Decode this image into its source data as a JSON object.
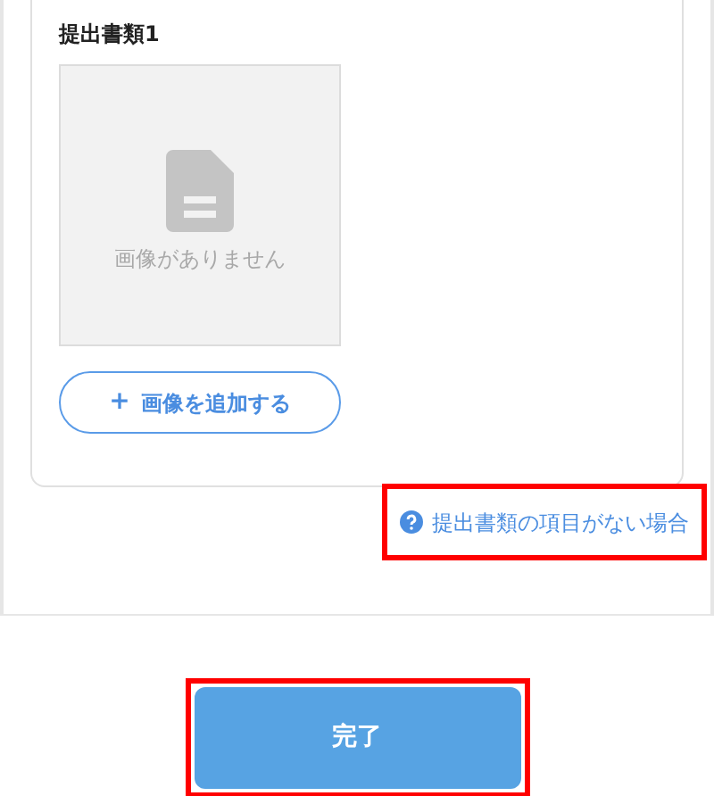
{
  "document_section": {
    "title": "提出書類1",
    "image_placeholder": {
      "text": "画像がありません"
    },
    "add_image_button": {
      "icon": "+",
      "label": "画像を追加する"
    }
  },
  "help_link": {
    "label": "提出書類の項目がない場合",
    "highlighted": true
  },
  "complete_button": {
    "label": "完了",
    "highlighted": true
  }
}
